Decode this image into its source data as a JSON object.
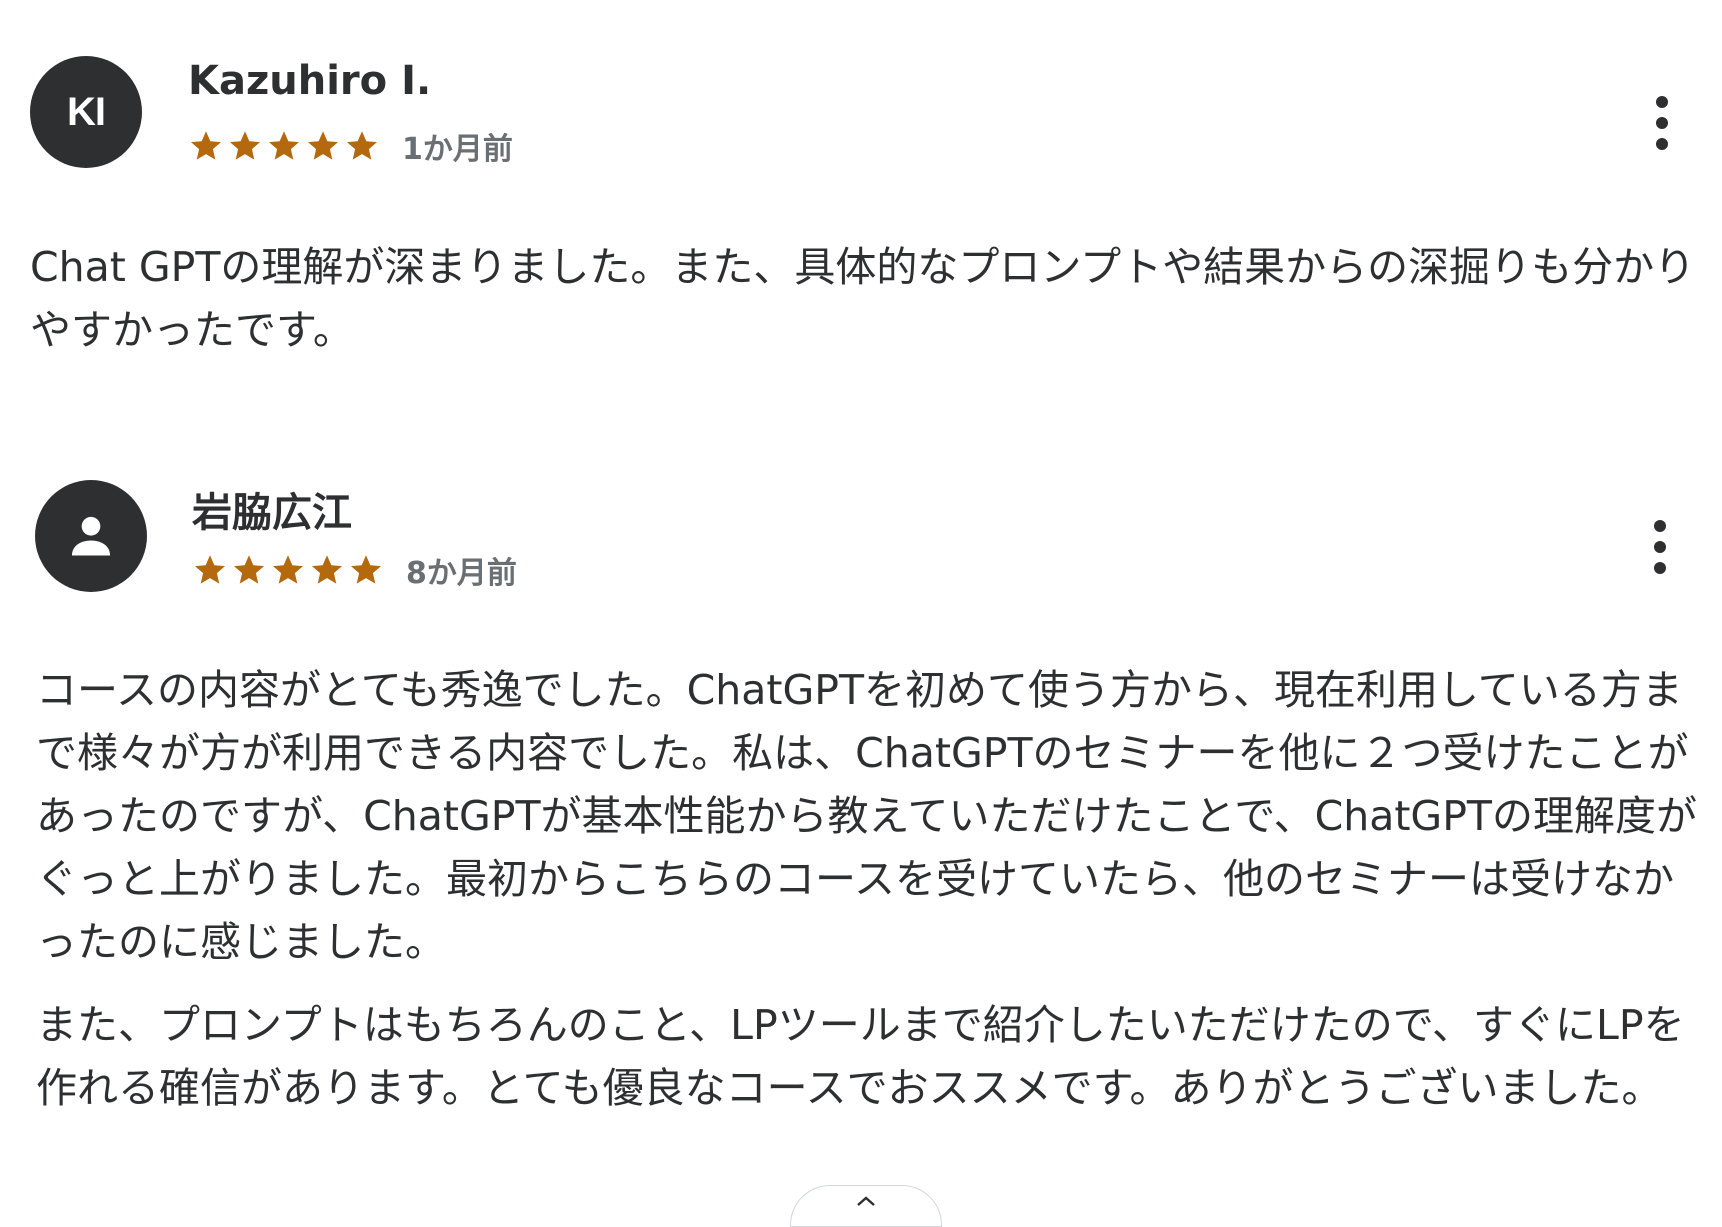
{
  "reviews": [
    {
      "avatar": {
        "type": "initials",
        "initials": "KI"
      },
      "name": "Kazuhiro I.",
      "rating": 5,
      "date": "1か月前",
      "paragraphs": [
        "Chat GPTの理解が深まりました。また、具体的なプロンプトや結果からの深掘りも分かりやすかったです。"
      ]
    },
    {
      "avatar": {
        "type": "icon",
        "icon": "user-icon"
      },
      "name": "岩脇広江",
      "rating": 5,
      "date": "8か月前",
      "paragraphs": [
        "コースの内容がとても秀逸でした。ChatGPTを初めて使う方から、現在利用している方まで様々が方が利用できる内容でした。私は、ChatGPTのセミナーを他に２つ受けたことがあったのですが、ChatGPTが基本性能から教えていただけたことで、ChatGPTの理解度がぐっと上がりました。最初からこちらのコースを受けていたら、他のセミナーは受けなかったのに感じました。",
        "また、プロンプトはもちろんのこと、LPツールまで紹介したいただけたので、すぐにLPを作れる確信があります。とても優良なコースでおススメです。ありがとうございました。"
      ]
    }
  ],
  "colors": {
    "star": "#b4690e",
    "avatar_bg": "#2d2f31",
    "text": "#2d2f31",
    "muted": "#6a6f73"
  },
  "icons": {
    "more_menu": "more-vertical-icon",
    "collapse": "chevron-up-icon"
  }
}
